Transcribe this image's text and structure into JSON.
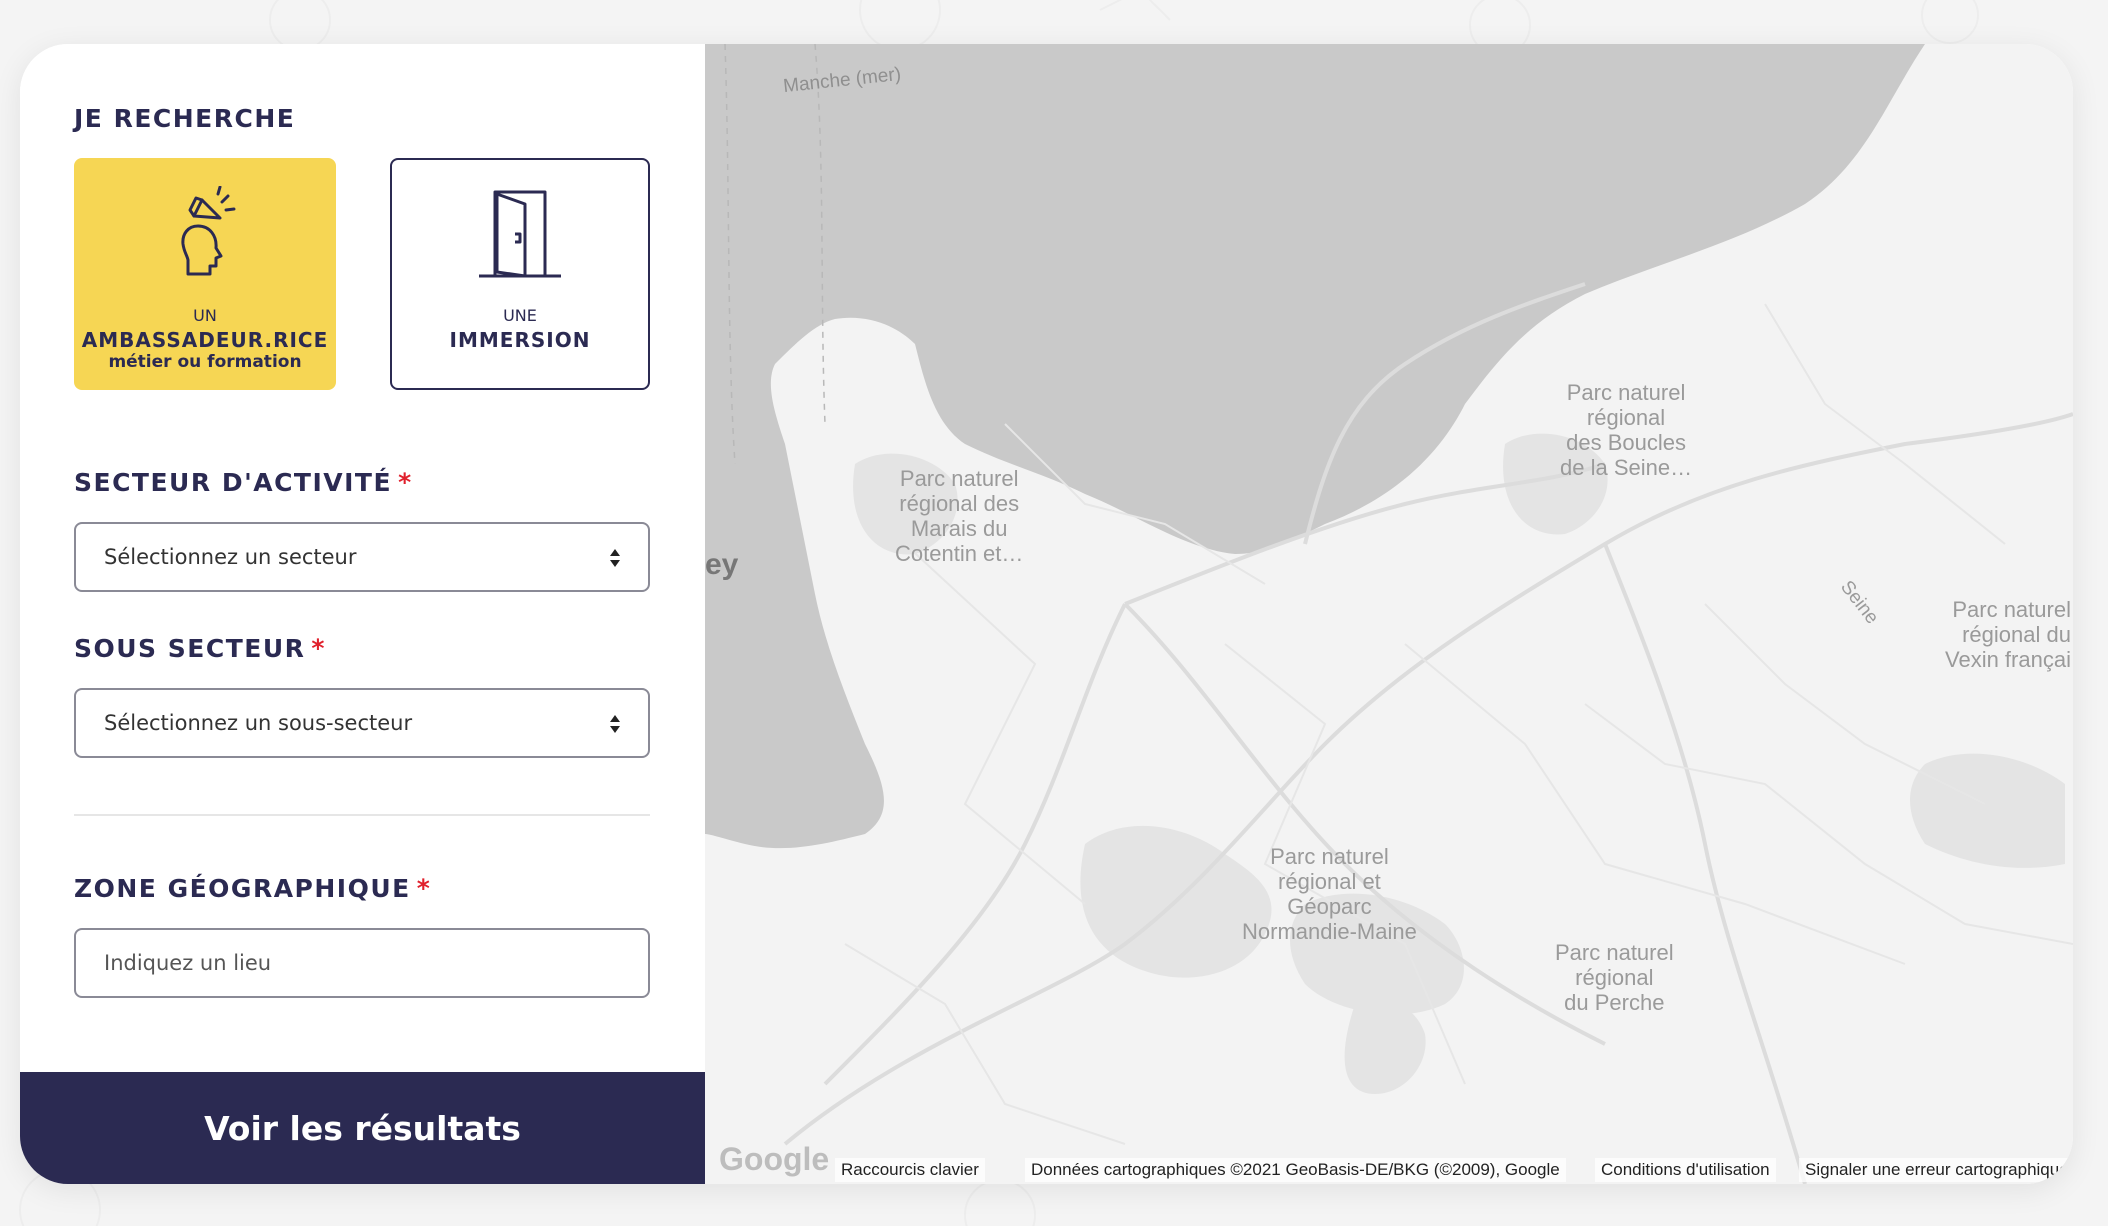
{
  "search": {
    "heading": "JE RECHERCHE",
    "option_ambassador": {
      "small": "UN",
      "title": "AMBASSADEUR.RICE",
      "sub": "métier ou formation",
      "selected": true
    },
    "option_immersion": {
      "small": "UNE",
      "title": "IMMERSION",
      "selected": false
    }
  },
  "sector": {
    "label": "SECTEUR D'ACTIVITÉ",
    "required": "*",
    "placeholder": "Sélectionnez un secteur"
  },
  "subsector": {
    "label": "SOUS SECTEUR",
    "required": "*",
    "placeholder": "Sélectionnez un sous-secteur"
  },
  "zone": {
    "label": "ZONE GÉOGRAPHIQUE",
    "required": "*",
    "placeholder": "Indiquez un lieu"
  },
  "submit_label": "Voir les résultats",
  "map": {
    "labels": {
      "sea": "Manche (mer)",
      "park_marais": "Parc naturel\nrégional des\nMarais du\nCotentin et…",
      "park_boucles": "Parc naturel\nrégional\ndes Boucles\nde la Seine…",
      "park_normandie": "Parc naturel\nrégional et\nGéoparc\nNormandie-Maine",
      "park_perche": "Parc naturel\nrégional\ndu Perche",
      "park_vexin": "Parc naturel\nrégional du\nVexin françai",
      "river_seine": "Seine",
      "place_partial": "ey"
    },
    "google_logo": "Google",
    "attribution": {
      "shortcuts": "Raccourcis clavier",
      "data": "Données cartographiques ©2021 GeoBasis-DE/BKG (©2009), Google",
      "terms": "Conditions d'utilisation",
      "report": "Signaler une erreur cartographique"
    }
  },
  "colors": {
    "navy": "#2b2a52",
    "yellow": "#f6d654",
    "required": "#e0202c",
    "sea": "#c9c9c9",
    "land": "#f3f3f3"
  }
}
